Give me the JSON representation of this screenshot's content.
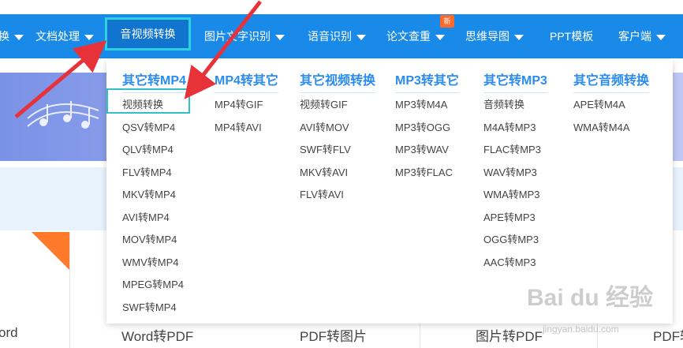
{
  "nav": {
    "items": [
      {
        "label": "换",
        "caret": true
      },
      {
        "label": "文档处理",
        "caret": true
      },
      {
        "label": "音视频转换",
        "caret": true,
        "active": true
      },
      {
        "label": "图片文字识别",
        "caret": true
      },
      {
        "label": "语音识别",
        "caret": true
      },
      {
        "label": "论文查重",
        "caret": true,
        "badge": "新"
      },
      {
        "label": "思维导图",
        "caret": true
      },
      {
        "label": "PPT模板",
        "caret": false
      },
      {
        "label": "客户端",
        "caret": true
      }
    ]
  },
  "dropdown": {
    "columns": [
      {
        "title": "其它转MP4",
        "items": [
          "视频转换",
          "QSV转MP4",
          "QLV转MP4",
          "FLV转MP4",
          "MKV转MP4",
          "AVI转MP4",
          "MOV转MP4",
          "WMV转MP4",
          "MPEG转MP4",
          "SWF转MP4"
        ]
      },
      {
        "title": "MP4转其它",
        "items": [
          "MP4转GIF",
          "MP4转AVI"
        ]
      },
      {
        "title": "其它视频转换",
        "items": [
          "视频转GIF",
          "AVI转MOV",
          "SWF转FLV",
          "MKV转AVI",
          "FLV转AVI"
        ]
      },
      {
        "title": "MP3转其它",
        "items": [
          "MP3转M4A",
          "MP3转OGG",
          "MP3转WAV",
          "MP3转FLAC"
        ]
      },
      {
        "title": "其它转MP3",
        "items": [
          "音频转换",
          "M4A转MP3",
          "FLAC转MP3",
          "WAV转MP3",
          "WMA转MP3",
          "APE转MP3",
          "OGG转MP3",
          "AAC转MP3"
        ]
      },
      {
        "title": "其它音频转换",
        "items": [
          "APE转M4A",
          "WMA转M4A"
        ]
      }
    ]
  },
  "bottom": {
    "labels": [
      "ord",
      "Word转PDF",
      "PDF转图片",
      "图片转PDF",
      "PDF转"
    ]
  },
  "watermark": {
    "text": "Bai du 经验",
    "url": "jingyan.baidu.com"
  },
  "colors": {
    "nav_bg": "#1a8ae8",
    "accent": "#2a8cf0",
    "highlight": "#2fc0c8",
    "arrow": "#e8323a"
  }
}
